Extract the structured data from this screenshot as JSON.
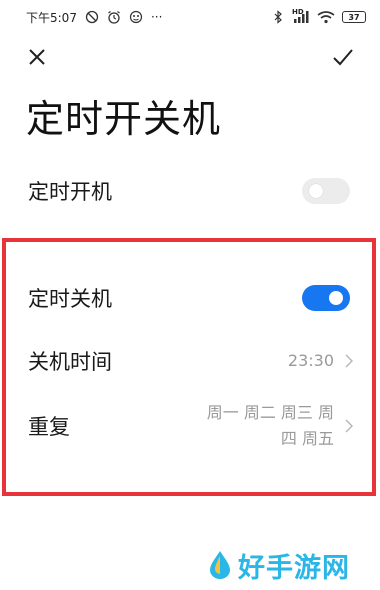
{
  "status_bar": {
    "time": "下午5:07",
    "more": "···",
    "network_badge": "HD",
    "battery": "37"
  },
  "toolbar": {
    "close_icon": "close-icon",
    "confirm_icon": "checkmark-icon"
  },
  "page": {
    "title": "定时开关机"
  },
  "settings": {
    "power_on": {
      "label": "定时开机",
      "enabled": false
    },
    "power_off": {
      "label": "定时关机",
      "enabled": true
    },
    "shutdown_time": {
      "label": "关机时间",
      "value": "23:30"
    },
    "repeat": {
      "label": "重复",
      "value_line1": "周一 周二 周三 周",
      "value_line2": "四 周五"
    }
  },
  "colors": {
    "toggle_on": "#1677f0",
    "toggle_off": "#ececec",
    "highlight": "#e8333a",
    "watermark": "#2bb6e8"
  },
  "watermark": {
    "text": "好手游网"
  }
}
